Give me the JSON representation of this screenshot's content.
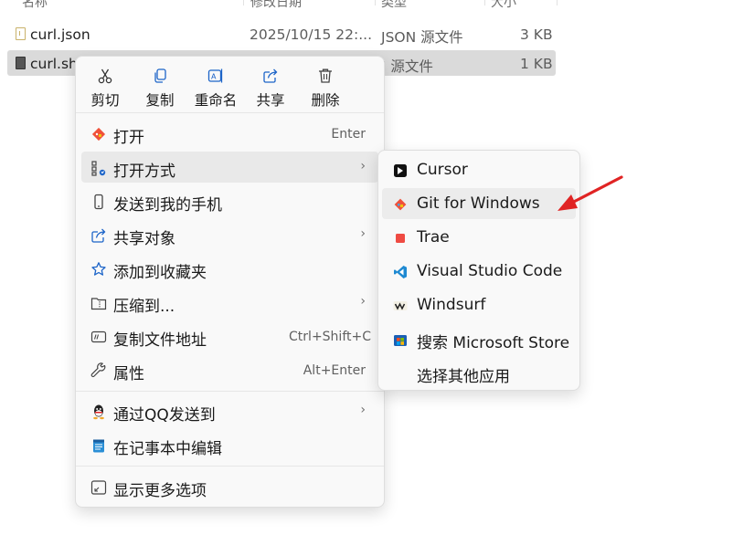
{
  "columns": {
    "name": "名称",
    "date": "修改日期",
    "type": "类型",
    "size": "大小"
  },
  "files": [
    {
      "name": "curl.json",
      "date": "2025/10/15 22:...",
      "type": "JSON 源文件",
      "size": "3 KB"
    },
    {
      "name": "curl.sh",
      "date": "",
      "type": "SH 源文件",
      "size": "1 KB"
    }
  ],
  "context_menu": {
    "quick_actions": [
      {
        "label": "剪切",
        "icon": "scissors-icon"
      },
      {
        "label": "复制",
        "icon": "copy-icon"
      },
      {
        "label": "重命名",
        "icon": "rename-icon"
      },
      {
        "label": "共享",
        "icon": "share-icon"
      },
      {
        "label": "删除",
        "icon": "trash-icon"
      }
    ],
    "items": [
      {
        "label": "打开",
        "shortcut": "Enter"
      },
      {
        "label": "打开方式"
      },
      {
        "label": "发送到我的手机"
      },
      {
        "label": "共享对象"
      },
      {
        "label": "添加到收藏夹"
      },
      {
        "label": "压缩到..."
      },
      {
        "label": "复制文件地址",
        "shortcut": "Ctrl+Shift+C"
      },
      {
        "label": "属性",
        "shortcut": "Alt+Enter"
      },
      {
        "label": "通过QQ发送到"
      },
      {
        "label": "在记事本中编辑"
      },
      {
        "label": "显示更多选项"
      }
    ]
  },
  "open_with_submenu": {
    "items": [
      {
        "label": "Cursor"
      },
      {
        "label": "Git for Windows"
      },
      {
        "label": "Trae"
      },
      {
        "label": "Visual Studio Code"
      },
      {
        "label": "Windsurf"
      },
      {
        "label": "搜索 Microsoft Store"
      },
      {
        "label": "选择其他应用"
      }
    ]
  },
  "colors": {
    "annotation_arrow": "#e02424",
    "menu_bg": "#f9f9f9",
    "selection": "#dadada"
  }
}
